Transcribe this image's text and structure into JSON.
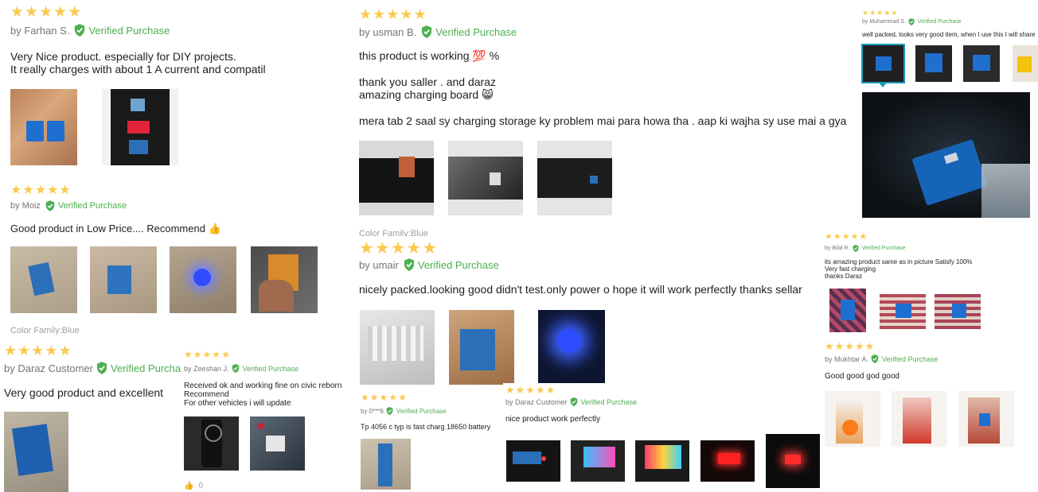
{
  "colors": {
    "star": "#faca51",
    "verified": "#4caf50",
    "accent": "#1a9cb7",
    "text": "#212121",
    "muted": "#757575"
  },
  "icons": {
    "star": "star-icon",
    "verified": "verified-shield-icon",
    "thumb": "thumbs-up-icon"
  },
  "reviews": {
    "farhan": {
      "rating": 5,
      "author": "by Farhan S.",
      "verified": "Verified Purchase",
      "text": "Very Nice product. especially for DIY projects.\nIt really charges with about 1 A current and compatil"
    },
    "moiz": {
      "rating": 5,
      "author": "by Moiz",
      "verified": "Verified Purchase",
      "text": "Good product in Low Price.... Recommend 👍",
      "color_family": "Color Family:Blue"
    },
    "daraz1": {
      "rating": 5,
      "author": "by Daraz Customer",
      "verified": "Verified Purchase",
      "text": "Very good product and excellent"
    },
    "zeeshan": {
      "rating": 5,
      "author": "by Zeeshan J.",
      "verified": "Verified Purchase",
      "text": "Received ok and working fine on civic reborn\nRecommend\nFor other vehicles i will update",
      "likes": "0"
    },
    "usman": {
      "rating": 5,
      "author": "by usman B.",
      "verified": "Verified Purchase",
      "text1": "this product is working 💯 %",
      "text2": "thank you saller . and daraz\namazing charging board 😸",
      "text3": "mera tab 2 saal sy charging storage ky problem mai para howa tha . aap ki wajha sy use mai a gya",
      "color_family": "Color Family:Blue"
    },
    "umair": {
      "rating": 5,
      "author": "by umair",
      "verified": "Verified Purchase",
      "text": "nicely packed.looking good didn't test.only power o hope it will work perfectly thanks sellar"
    },
    "o6": {
      "rating": 5,
      "author": "by 0***6",
      "verified": "Verified Purchase",
      "text": "Tp 4056 c typ is fast charg 18650 battery"
    },
    "daraz2": {
      "rating": 5,
      "author": "by Daraz Customer",
      "verified": "Verified Purchase",
      "text": "nice product work perfectly"
    },
    "muhammad": {
      "rating": 5,
      "author": "by Muhammad S.",
      "verified": "Verified Purchase",
      "text": "well packed, looks very good item, when I use this I will share"
    },
    "bilal": {
      "rating": 5,
      "author": "by Bilal R.",
      "verified": "Verified Purchase",
      "text": "its amazing product same as in picture Satisfy 100%\nVery fast charging\n thanks Daraz"
    },
    "mukhtar": {
      "rating": 5,
      "author": "by Mukhtar A.",
      "verified": "Verified Purchase",
      "text": "Good good god good"
    }
  }
}
